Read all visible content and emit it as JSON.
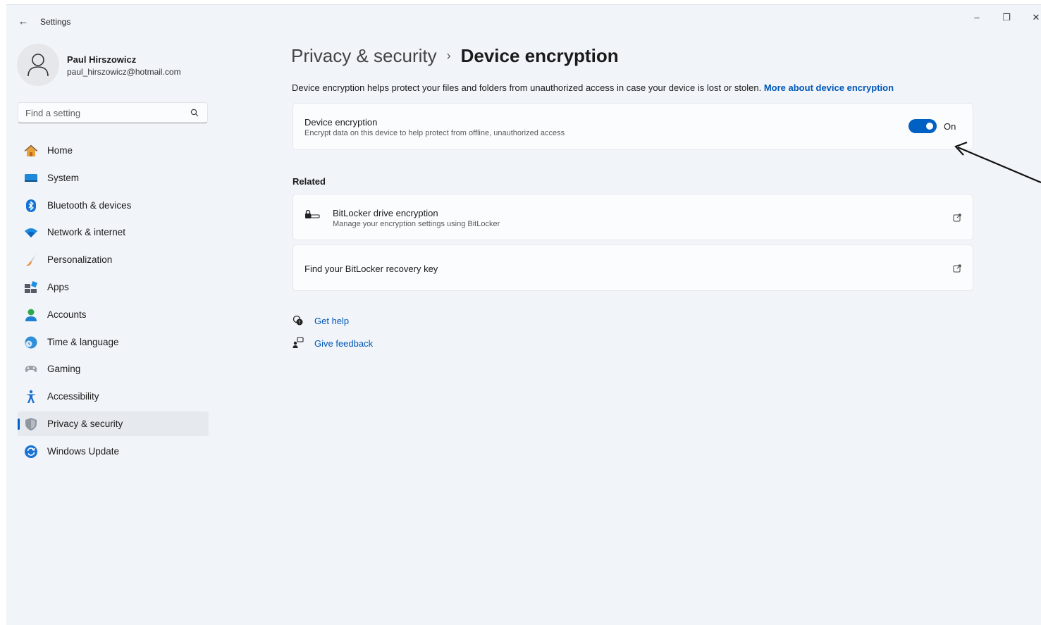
{
  "window": {
    "title": "Settings",
    "back_icon": "back-arrow-icon",
    "minimize": "–",
    "restore": "❐",
    "close": "✕"
  },
  "user": {
    "name": "Paul Hirszowicz",
    "email": "paul_hirszowicz@hotmail.com"
  },
  "search": {
    "placeholder": "Find a setting"
  },
  "nav": {
    "items": [
      {
        "label": "Home",
        "icon": "home-icon"
      },
      {
        "label": "System",
        "icon": "system-icon"
      },
      {
        "label": "Bluetooth & devices",
        "icon": "bluetooth-icon"
      },
      {
        "label": "Network & internet",
        "icon": "wifi-icon"
      },
      {
        "label": "Personalization",
        "icon": "brush-icon"
      },
      {
        "label": "Apps",
        "icon": "apps-icon"
      },
      {
        "label": "Accounts",
        "icon": "person-icon"
      },
      {
        "label": "Time & language",
        "icon": "globe-clock-icon"
      },
      {
        "label": "Gaming",
        "icon": "gamepad-icon"
      },
      {
        "label": "Accessibility",
        "icon": "accessibility-icon"
      },
      {
        "label": "Privacy & security",
        "icon": "shield-icon",
        "selected": true
      },
      {
        "label": "Windows Update",
        "icon": "update-icon"
      }
    ]
  },
  "main": {
    "breadcrumb": {
      "parent": "Privacy & security",
      "separator": "›",
      "current": "Device encryption"
    },
    "description": "Device encryption helps protect your files and folders from unauthorized access in case your device is lost or stolen.",
    "description_link": "More about device encryption",
    "encryption_card": {
      "title": "Device encryption",
      "subtitle": "Encrypt data on this device to help protect from offline, unauthorized access",
      "toggle_state": "On"
    },
    "related_label": "Related",
    "related": [
      {
        "title": "BitLocker drive encryption",
        "subtitle": "Manage your encryption settings using BitLocker",
        "icon": "bitlocker-icon"
      },
      {
        "title": "Find your BitLocker recovery key"
      }
    ],
    "help": {
      "get_help": "Get help",
      "give_feedback": "Give feedback"
    }
  },
  "colors": {
    "accent": "#0060c4",
    "link": "#0057b7",
    "window_bg": "#f1f4f9",
    "card_bg": "#fbfcfd"
  }
}
